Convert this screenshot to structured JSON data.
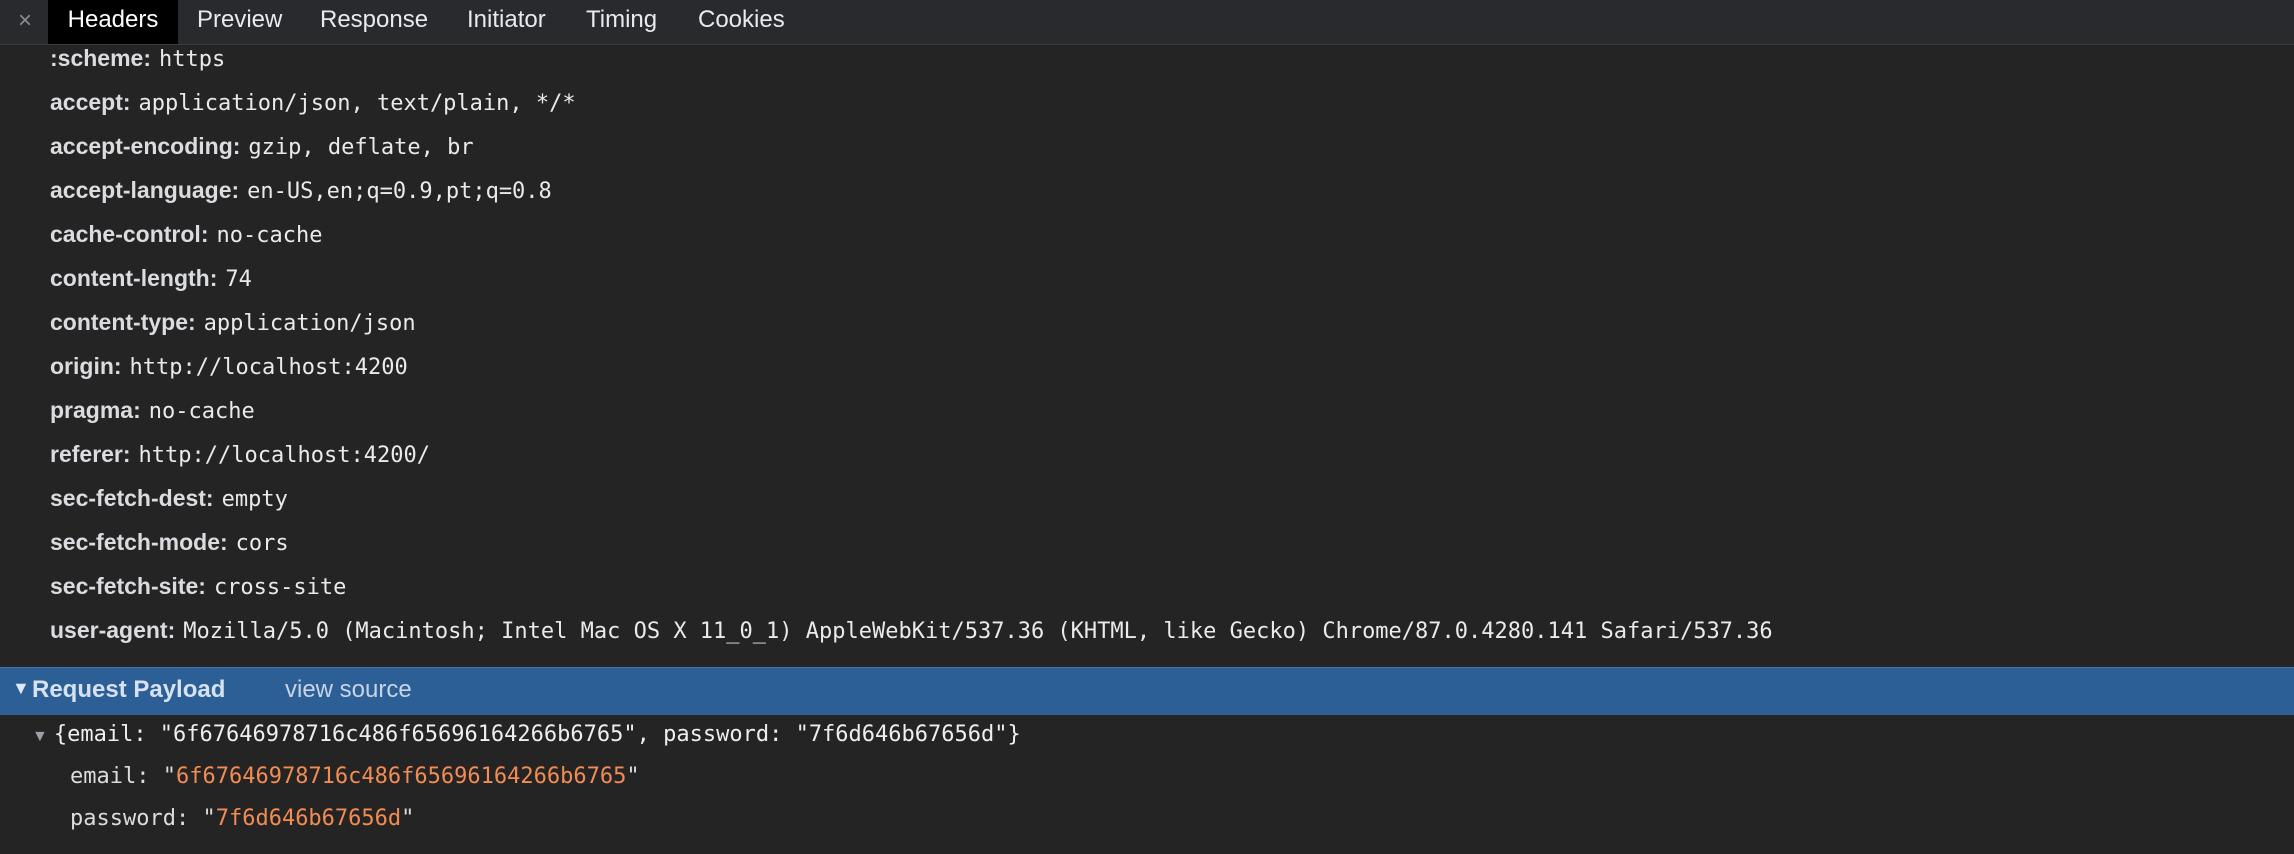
{
  "tabs": {
    "close_glyph": "×",
    "items": [
      {
        "label": "Headers",
        "active": true
      },
      {
        "label": "Preview",
        "active": false
      },
      {
        "label": "Response",
        "active": false
      },
      {
        "label": "Initiator",
        "active": false
      },
      {
        "label": "Timing",
        "active": false
      },
      {
        "label": "Cookies",
        "active": false
      }
    ]
  },
  "request_headers": [
    {
      "name": ":scheme:",
      "value": "https"
    },
    {
      "name": "accept:",
      "value": "application/json, text/plain, */*"
    },
    {
      "name": "accept-encoding:",
      "value": "gzip, deflate, br"
    },
    {
      "name": "accept-language:",
      "value": "en-US,en;q=0.9,pt;q=0.8"
    },
    {
      "name": "cache-control:",
      "value": "no-cache"
    },
    {
      "name": "content-length:",
      "value": "74"
    },
    {
      "name": "content-type:",
      "value": "application/json"
    },
    {
      "name": "origin:",
      "value": "http://localhost:4200"
    },
    {
      "name": "pragma:",
      "value": "no-cache"
    },
    {
      "name": "referer:",
      "value": "http://localhost:4200/"
    },
    {
      "name": "sec-fetch-dest:",
      "value": "empty"
    },
    {
      "name": "sec-fetch-mode:",
      "value": "cors"
    },
    {
      "name": "sec-fetch-site:",
      "value": "cross-site"
    },
    {
      "name": "user-agent:",
      "value": "Mozilla/5.0 (Macintosh; Intel Mac OS X 11_0_1) AppleWebKit/537.36 (KHTML, like Gecko) Chrome/87.0.4280.141 Safari/537.36"
    }
  ],
  "payload": {
    "title": "Request Payload",
    "view_source_label": "view source",
    "summary": "{email: \"6f67646978716c486f65696164266b6765\", password: \"7f6d646b67656d\"}",
    "properties": [
      {
        "key": "email:",
        "value": "6f67646978716c486f65696164266b6765"
      },
      {
        "key": "password:",
        "value": "7f6d646b67656d"
      }
    ]
  },
  "colors": {
    "panel_background": "#242424",
    "tabbar_background": "#292a2d",
    "active_tab_background": "#000000",
    "section_header_background": "#2c5f96",
    "string_value": "#f28b54"
  }
}
